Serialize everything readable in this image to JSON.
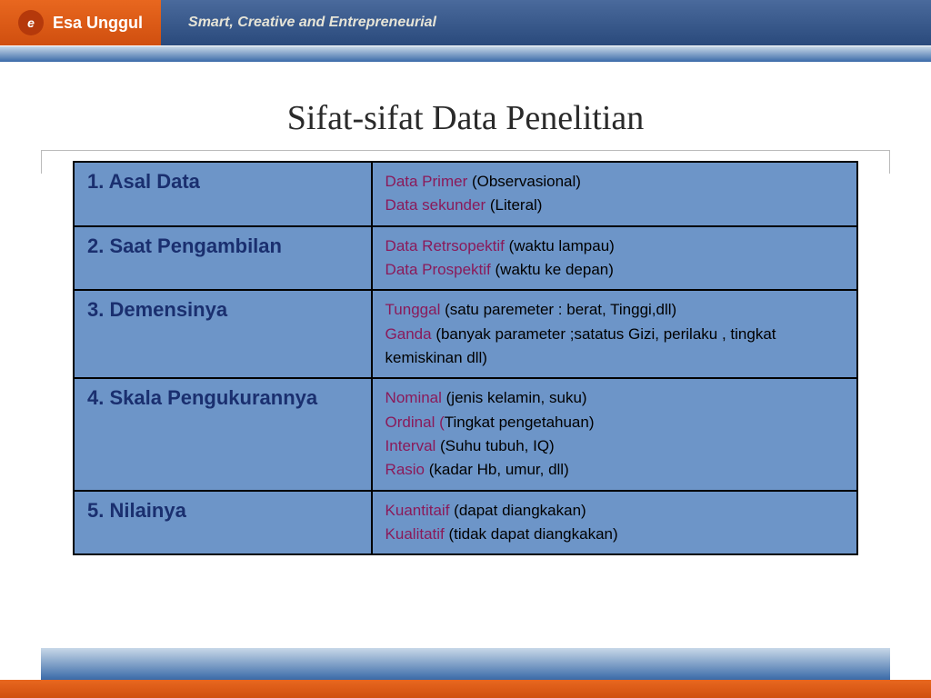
{
  "header": {
    "brand": "Esa Unggul",
    "logo_letter": "e",
    "tagline": "Smart, Creative and Entrepreneurial"
  },
  "title": "Sifat-sifat Data Penelitian",
  "rows": [
    {
      "category": "1. Asal Data",
      "items": [
        {
          "term": "Data Primer",
          "desc": " (Observasional)"
        },
        {
          "term": "Data sekunder",
          "desc": " (Literal)"
        }
      ]
    },
    {
      "category": "2. Saat Pengambilan",
      "items": [
        {
          "term": "Data Retrsopektif",
          "desc": " (waktu lampau)"
        },
        {
          "term": "Data Prospektif",
          "desc": " (waktu ke depan)"
        }
      ]
    },
    {
      "category": "3. Demensinya",
      "items": [
        {
          "term": "Tunggal",
          "desc": " (satu paremeter : berat, Tinggi,dll)"
        },
        {
          "term": "Ganda",
          "desc": " (banyak parameter ;satatus Gizi, perilaku , tingkat kemiskinan dll)"
        }
      ]
    },
    {
      "category": "4. Skala Pengukurannya",
      "items": [
        {
          "term": "Nominal",
          "desc": " (jenis kelamin, suku)"
        },
        {
          "term": "Ordinal (",
          "desc": "Tingkat pengetahuan)"
        },
        {
          "term": "Interval",
          "desc": " (Suhu tubuh, IQ)"
        },
        {
          "term": "Rasio",
          "desc": " (kadar Hb, umur, dll)"
        }
      ]
    },
    {
      "category": "5. Nilainya",
      "items": [
        {
          "term": "Kuantitaif",
          "desc": " (dapat diangkakan)"
        },
        {
          "term": "Kualitatif",
          "desc": " (tidak dapat diangkakan)"
        }
      ]
    }
  ]
}
